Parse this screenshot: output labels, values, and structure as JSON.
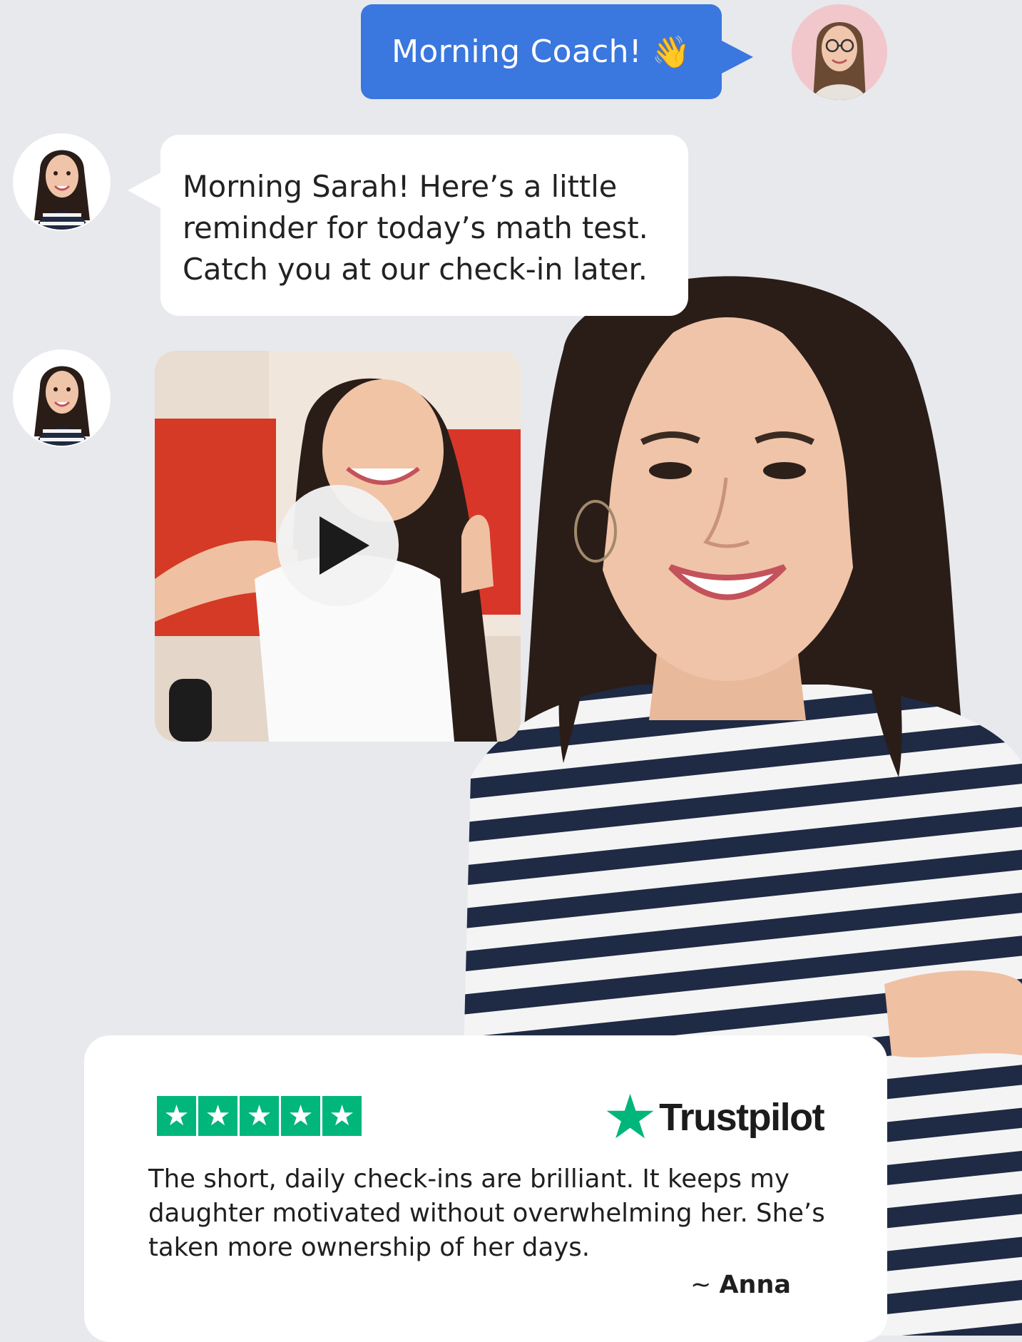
{
  "chat": {
    "outgoing": {
      "text": "Morning Coach!",
      "emoji": "👋"
    },
    "incoming": {
      "line1": "Morning Sarah! Here’s a little",
      "line2": "reminder for today’s math test.",
      "line3": "Catch you at our check-in later."
    }
  },
  "video": {
    "icon": "play-icon"
  },
  "review": {
    "rating": 5,
    "star_glyph": "★",
    "brand_star": "★",
    "brand": "Trustpilot",
    "text": "The short, daily check-ins are brilliant. It keeps my daughter motivated without overwhelming her. She’s taken more ownership of her days.",
    "author_prefix": "~",
    "author": "Anna"
  },
  "colors": {
    "background": "#e7e9ed",
    "outgoing_bubble": "#3a77de",
    "trustpilot_green": "#00b67a"
  }
}
